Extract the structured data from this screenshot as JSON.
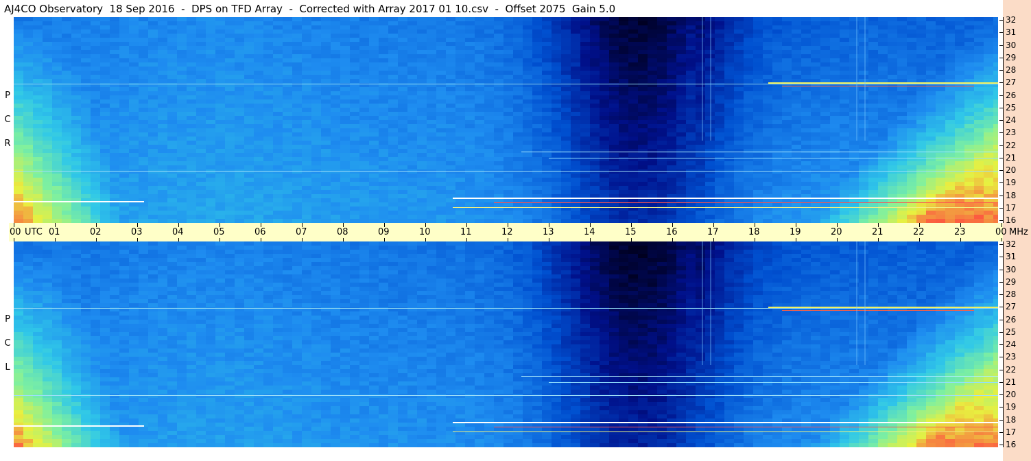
{
  "title": "AJ4CO Observatory  18 Sep 2016  -  DPS on TFD Array  -  Corrected with Array 2017 01 10.csv  -  Offset 2075  Gain 5.0",
  "panels": [
    {
      "id": "top",
      "polarization_letters": [
        "R",
        "C",
        "P"
      ]
    },
    {
      "id": "bottom",
      "polarization_letters": [
        "L",
        "C",
        "P"
      ]
    }
  ],
  "time_axis": {
    "labels": [
      "00",
      "01",
      "02",
      "03",
      "04",
      "05",
      "06",
      "07",
      "08",
      "09",
      "10",
      "11",
      "12",
      "13",
      "14",
      "15",
      "16",
      "17",
      "18",
      "19",
      "20",
      "21",
      "22",
      "23",
      "00"
    ],
    "unit_label": "UTC",
    "freq_unit_label": "MHz"
  },
  "freq_axis": {
    "labels": [
      "32",
      "31",
      "30",
      "29",
      "28",
      "27",
      "26",
      "25",
      "24",
      "23",
      "22",
      "21",
      "20",
      "19",
      "18",
      "17",
      "16"
    ]
  },
  "colors": {
    "background": "#ffffff",
    "axis_band": "#ffffc8",
    "right_strip": "#fbdcc7",
    "colormap": [
      "#000020",
      "#00108a",
      "#0050d0",
      "#1e8cf0",
      "#30c8e8",
      "#7ef0a0",
      "#e8f040",
      "#ff4040",
      "#ffffff"
    ]
  }
}
